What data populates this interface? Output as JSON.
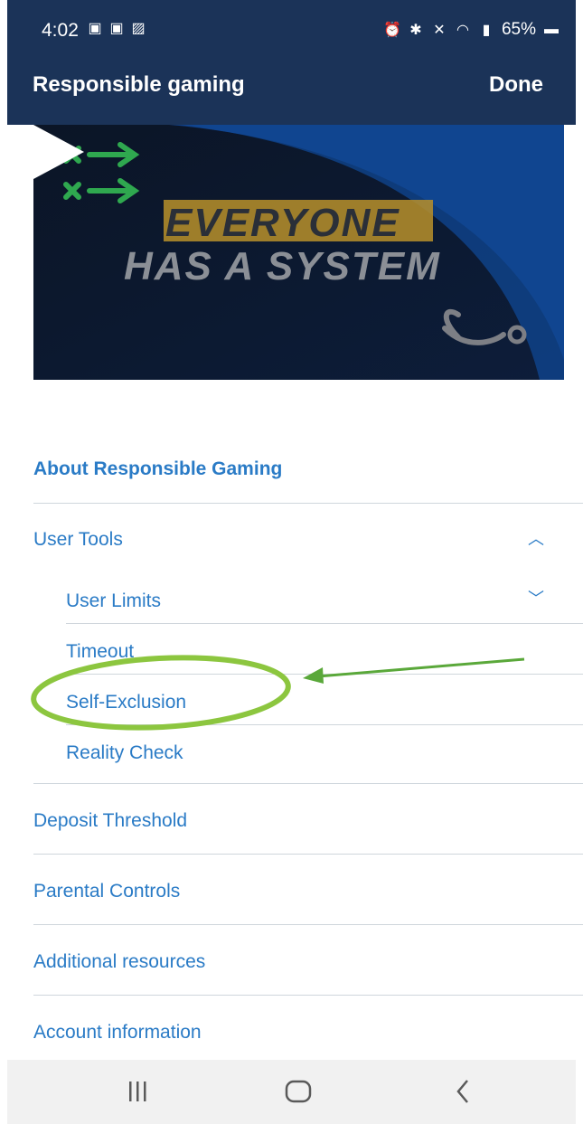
{
  "status": {
    "time": "4:02",
    "battery": "65%"
  },
  "header": {
    "title": "Responsible gaming",
    "done_label": "Done"
  },
  "video": {
    "line1": "EVERYONE",
    "line2": "HAS A SYSTEM"
  },
  "menu": {
    "about": "About Responsible Gaming",
    "user_tools": "User Tools",
    "user_limits": "User Limits",
    "timeout": "Timeout",
    "self_exclusion": "Self-Exclusion",
    "reality_check": "Reality Check",
    "deposit_threshold": "Deposit Threshold",
    "parental_controls": "Parental Controls",
    "additional_resources": "Additional resources",
    "account_information": "Account information"
  },
  "colors": {
    "header_bg": "#1b3358",
    "link": "#2a7bc6",
    "highlight": "#8cc63f"
  }
}
